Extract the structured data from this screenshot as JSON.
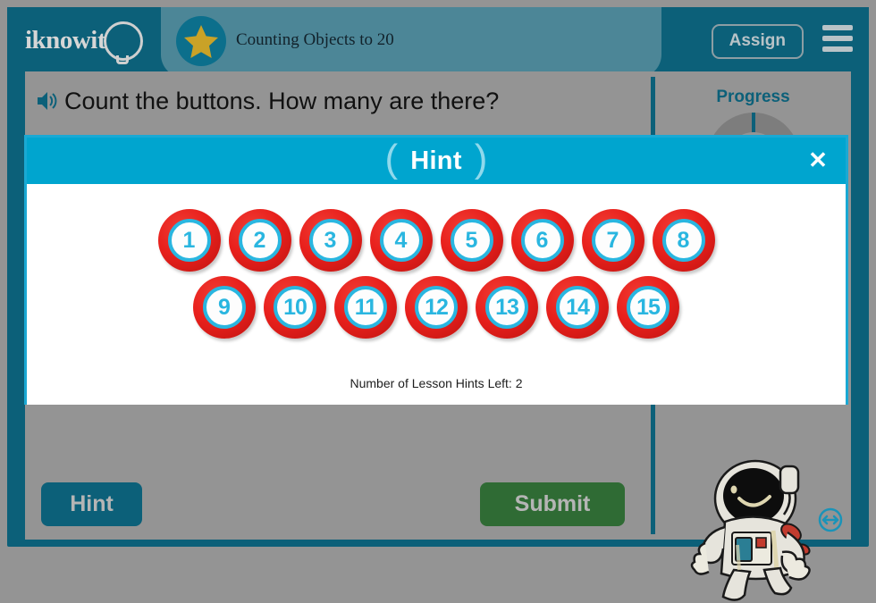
{
  "header": {
    "brand": "iknowit",
    "brand_bulb_icon": "lightbulb-icon",
    "lesson_title": "Counting Objects to 20",
    "star_icon": "star-icon",
    "assign_label": "Assign",
    "menu_icon": "hamburger-menu-icon"
  },
  "question": {
    "speaker_icon": "speaker-icon",
    "text": "Count the buttons. How many are there?"
  },
  "right_rail": {
    "progress_label": "Progress",
    "mascot_icon": "astronaut-mascot",
    "resize_icon": "resize-handle-icon"
  },
  "actions": {
    "hint_label": "Hint",
    "submit_label": "Submit"
  },
  "hint_modal": {
    "title": "Hint",
    "paren_left": "(",
    "paren_right": ")",
    "close_icon": "✕",
    "hints_left_text": "Number of Lesson Hints Left: 2",
    "rows": [
      [
        "1",
        "2",
        "3",
        "4",
        "5",
        "6",
        "7",
        "8"
      ],
      [
        "9",
        "10",
        "11",
        "12",
        "13",
        "14",
        "15"
      ]
    ]
  },
  "colors": {
    "frame_teal": "#0c6079",
    "panel_teal": "#4c8697",
    "page_gray": "#949494",
    "modal_cyan": "#00a5cf",
    "button_red": "#e8201c",
    "button_ring_cyan": "#29b6e0",
    "submit_green": "#2f6b34",
    "star_gold": "#c9a227"
  }
}
